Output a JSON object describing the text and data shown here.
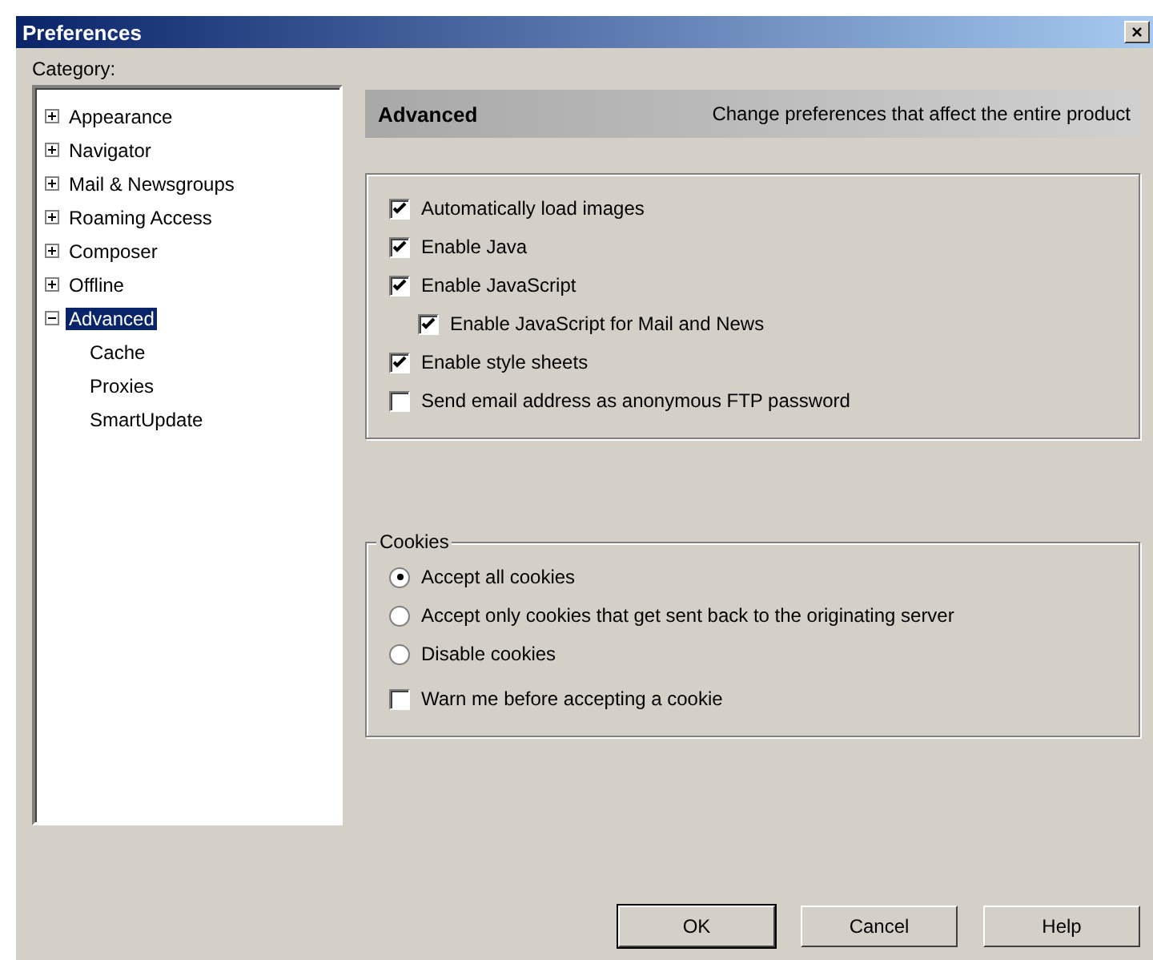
{
  "window": {
    "title": "Preferences",
    "close": "×"
  },
  "category_label": "Category:",
  "tree": [
    {
      "label": "Appearance",
      "expanded": false,
      "selected": false
    },
    {
      "label": "Navigator",
      "expanded": false,
      "selected": false
    },
    {
      "label": "Mail & Newsgroups",
      "expanded": false,
      "selected": false
    },
    {
      "label": "Roaming Access",
      "expanded": false,
      "selected": false
    },
    {
      "label": "Composer",
      "expanded": false,
      "selected": false
    },
    {
      "label": "Offline",
      "expanded": false,
      "selected": false
    },
    {
      "label": "Advanced",
      "expanded": true,
      "selected": true,
      "children": [
        {
          "label": "Cache",
          "selected": false
        },
        {
          "label": "Proxies",
          "selected": false
        },
        {
          "label": "SmartUpdate",
          "selected": false
        }
      ]
    }
  ],
  "header": {
    "title": "Advanced",
    "description": "Change preferences that affect the entire product"
  },
  "options": [
    {
      "label": "Automatically load images",
      "checked": true
    },
    {
      "label": "Enable Java",
      "checked": true
    },
    {
      "label": "Enable JavaScript",
      "checked": true,
      "children": [
        {
          "label": "Enable JavaScript for Mail and News",
          "checked": true
        }
      ]
    },
    {
      "label": "Enable style sheets",
      "checked": true
    },
    {
      "label": "Send email address as anonymous FTP password",
      "checked": false
    }
  ],
  "cookies": {
    "title": "Cookies",
    "choices": [
      {
        "label": "Accept all cookies",
        "selected": true
      },
      {
        "label": "Accept only cookies that get sent back to the originating server",
        "selected": false
      },
      {
        "label": "Disable cookies",
        "selected": false
      }
    ],
    "warn": {
      "label": "Warn me before accepting a cookie",
      "checked": false
    }
  },
  "buttons": [
    {
      "label": "OK",
      "default": true
    },
    {
      "label": "Cancel",
      "default": false
    },
    {
      "label": "Help",
      "default": false
    }
  ]
}
